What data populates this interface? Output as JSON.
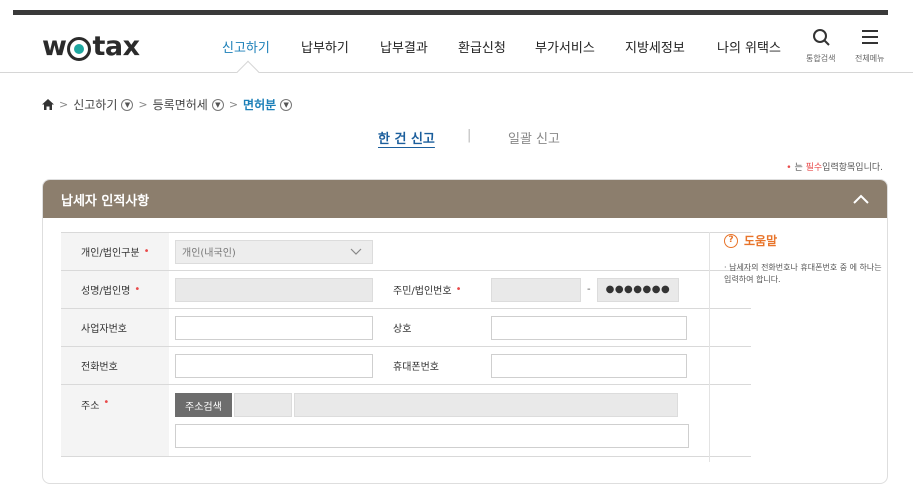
{
  "header": {
    "logo": {
      "pre": "w",
      "post": "tax"
    },
    "nav": [
      "신고하기",
      "납부하기",
      "납부결과",
      "환급신청",
      "부가서비스",
      "지방세정보",
      "나의 위택스"
    ],
    "search_label": "통합검색",
    "menu_label": "전체메뉴"
  },
  "breadcrumb": {
    "items": [
      "신고하기",
      "등록면허세",
      "면허분"
    ]
  },
  "subtabs": {
    "single": "한 건 신고",
    "separator": "|",
    "bulk": "일괄 신고"
  },
  "required_note": {
    "star": "•",
    "pre": "는",
    "pilsu": "필수",
    "post": "입력항목입니다."
  },
  "section": {
    "title": "납세자 인적사항"
  },
  "form": {
    "req_mark": "•",
    "type_label": "개인/법인구분",
    "type_value": "개인(내국인)",
    "name_label": "성명/법인명",
    "rrn_label": "주민/법인번호",
    "rrn_dash": "-",
    "rrn_masked": "●●●●●●●",
    "bizno_label": "사업자번호",
    "trade_label": "상호",
    "phone_label": "전화번호",
    "mobile_label": "휴대폰번호",
    "address_label": "주소",
    "address_button": "주소검색"
  },
  "help": {
    "title": "도움말",
    "text": "· 납세자의 전화번호나 휴대폰번호 중 에 하나는 입력하여 합니다."
  },
  "colors": {
    "accent": "#1b7fb8",
    "section_header": "#8c7e6d",
    "required": "#e94b4b",
    "help": "#e8742a"
  }
}
